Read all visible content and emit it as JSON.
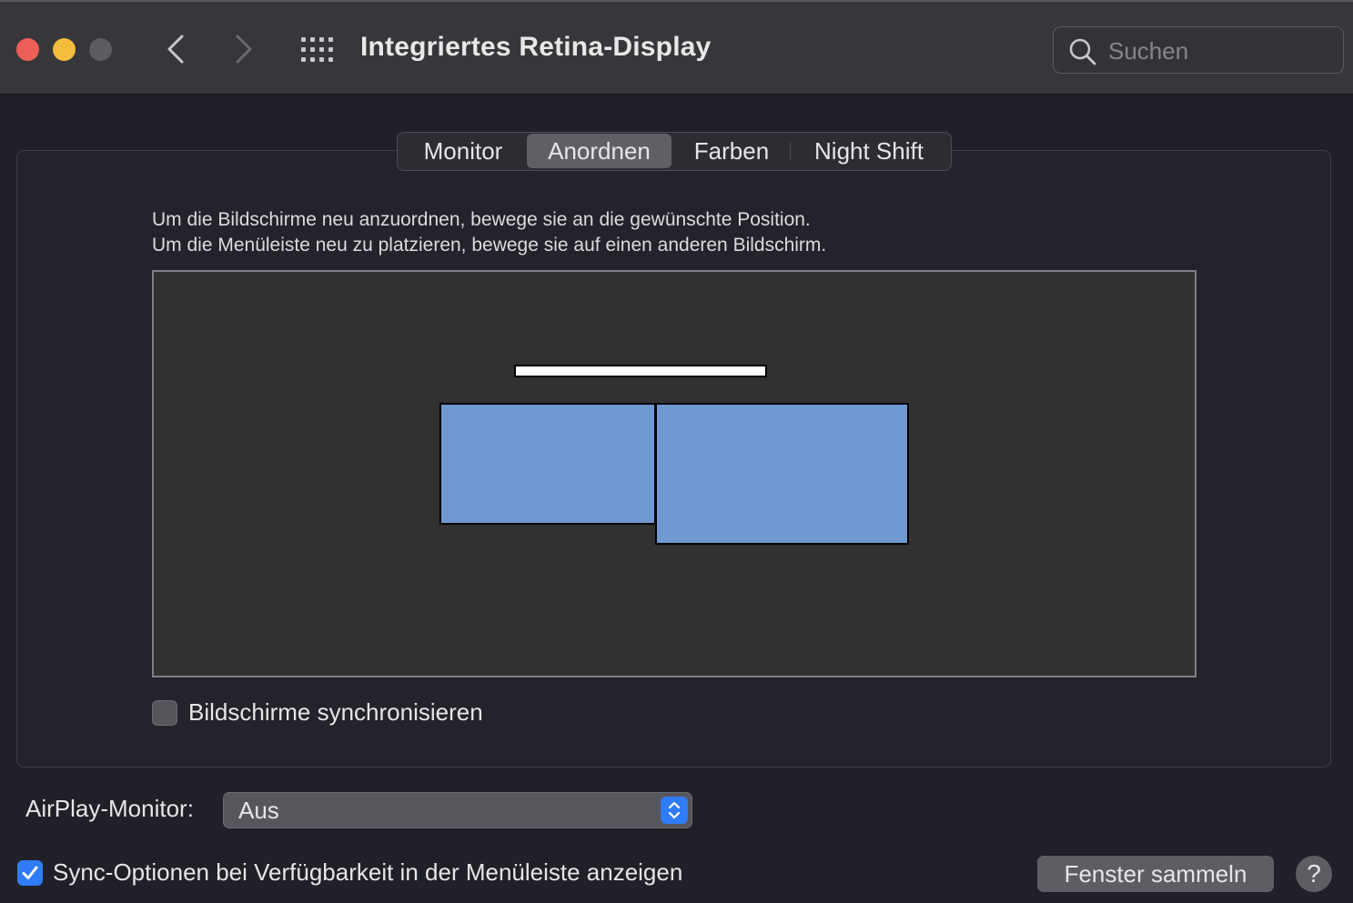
{
  "window": {
    "title": "Integriertes Retina-Display",
    "colors": {
      "close": "#ec5f58",
      "minimize": "#f4bd3e",
      "zoom_inactive": "#5c5c60"
    }
  },
  "search": {
    "placeholder": "Suchen",
    "value": ""
  },
  "tabs": [
    {
      "label": "Monitor",
      "active": false
    },
    {
      "label": "Anordnen",
      "active": true
    },
    {
      "label": "Farben",
      "active": false
    },
    {
      "label": "Night Shift",
      "active": false
    }
  ],
  "arrange": {
    "instruction_line1": "Um die Bildschirme neu anzuordnen, bewege sie an die gewünschte Position.",
    "instruction_line2": "Um die Menüleiste neu zu platzieren, bewege sie auf einen anderen Bildschirm.",
    "display_color": "#7099d1",
    "mirror_label": "Bildschirme synchronisieren",
    "mirror_checked": false
  },
  "airplay": {
    "label": "AirPlay-Monitor:",
    "value": "Aus"
  },
  "sync_options": {
    "label": "Sync-Optionen bei Verfügbarkeit in der Menüleiste anzeigen",
    "checked": true
  },
  "footer": {
    "gather_windows_label": "Fenster sammeln",
    "help_label": "?"
  },
  "accent_color": "#2f7cf6"
}
